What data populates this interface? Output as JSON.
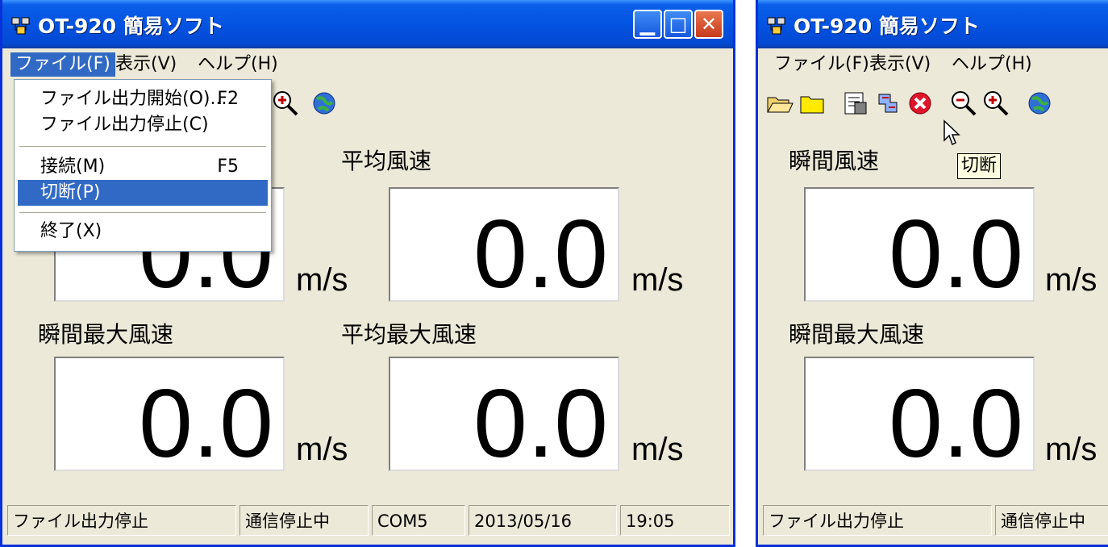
{
  "app_title": "OT-920 簡易ソフト",
  "menu": {
    "file": "ファイル(F)",
    "view": "表示(V)",
    "help": "ヘルプ(H)"
  },
  "file_menu": {
    "start_output": "ファイル出力開始(O)...",
    "start_output_key": "F2",
    "stop_output": "ファイル出力停止(C)",
    "connect": "接続(M)",
    "connect_key": "F5",
    "disconnect": "切断(P)",
    "exit": "終了(X)"
  },
  "labels": {
    "instant": "瞬間風速",
    "average": "平均風速",
    "instant_max": "瞬間最大風速",
    "average_max": "平均最大風速"
  },
  "readings": {
    "instant": "0.0",
    "average": "0.0",
    "instant_max": "0.0",
    "average_max": "0.0"
  },
  "unit": "m/s",
  "status": {
    "file": "ファイル出力停止",
    "comm": "通信停止中",
    "port": "COM5",
    "date": "2013/05/16",
    "time": "19:05"
  },
  "tooltip": "切断",
  "toolbar_icons": [
    "open-folder-icon",
    "folder-icon",
    "properties-icon",
    "connect-icon",
    "disconnect-icon",
    "zoom-out-icon",
    "zoom-in-icon",
    "globe-icon"
  ],
  "colors": {
    "titlebar": "#0453e2",
    "menu_highlight": "#316ac5",
    "face": "#ece9d8"
  }
}
